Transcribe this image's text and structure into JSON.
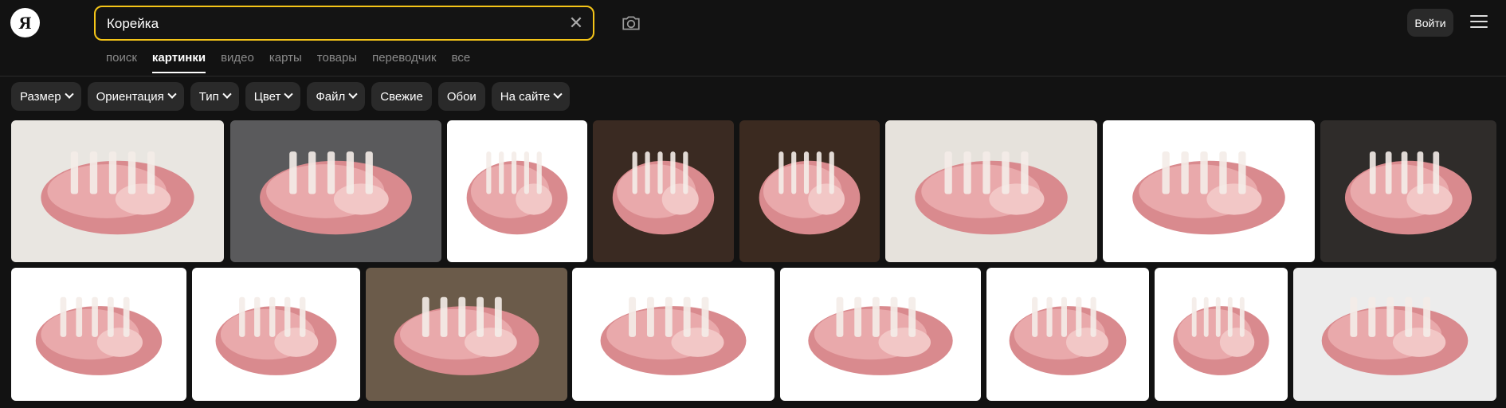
{
  "header": {
    "logo_letter": "Я",
    "search_value": "Корейка",
    "login_label": "Войти"
  },
  "tabs": [
    {
      "label": "поиск",
      "active": false
    },
    {
      "label": "картинки",
      "active": true
    },
    {
      "label": "видео",
      "active": false
    },
    {
      "label": "карты",
      "active": false
    },
    {
      "label": "товары",
      "active": false
    },
    {
      "label": "переводчик",
      "active": false
    },
    {
      "label": "все",
      "active": false
    }
  ],
  "filters": [
    {
      "label": "Размер",
      "dropdown": true
    },
    {
      "label": "Ориентация",
      "dropdown": true
    },
    {
      "label": "Тип",
      "dropdown": true
    },
    {
      "label": "Цвет",
      "dropdown": true
    },
    {
      "label": "Файл",
      "dropdown": true
    },
    {
      "label": "Свежие",
      "dropdown": false
    },
    {
      "label": "Обои",
      "dropdown": false
    },
    {
      "label": "На сайте",
      "dropdown": true
    }
  ],
  "images": [
    {
      "subject": "pork-loin-rack-on-board-with-tomatoes",
      "bg": "#e9e6e1"
    },
    {
      "subject": "pork-rack-on-dark-stone",
      "bg": "#5a5a5c"
    },
    {
      "subject": "pork-loin-on-plate",
      "bg": "#ffffff"
    },
    {
      "subject": "pork-ribs-closeup",
      "bg": "#3a2a22"
    },
    {
      "subject": "pork-chops-on-wood",
      "bg": "#3b2a20"
    },
    {
      "subject": "pork-rack-with-spices",
      "bg": "#e6e2dc"
    },
    {
      "subject": "pork-loin-white",
      "bg": "#ffffff"
    },
    {
      "subject": "pork-rack-on-dark-wood",
      "bg": "#2f2c2a"
    },
    {
      "subject": "pork-loin-cut-white",
      "bg": "#ffffff"
    },
    {
      "subject": "pork-rack-on-board",
      "bg": "#ffffff"
    },
    {
      "subject": "pork-chops-with-tomatoes",
      "bg": "#6b5b4a"
    },
    {
      "subject": "pork-loin-ribs-white",
      "bg": "#ffffff"
    },
    {
      "subject": "pork-rack-with-salad",
      "bg": "#ffffff"
    },
    {
      "subject": "pork-loin-slab",
      "bg": "#ffffff"
    },
    {
      "subject": "pork-chops-white",
      "bg": "#ffffff"
    },
    {
      "subject": "pork-loin-on-board-with-tomatoes",
      "bg": "#ececec"
    }
  ]
}
